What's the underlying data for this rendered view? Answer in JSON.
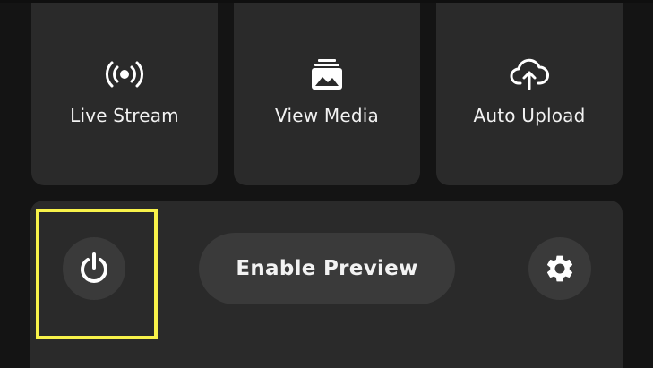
{
  "tiles": [
    {
      "label": "Live Stream",
      "icon": "live-stream-icon"
    },
    {
      "label": "View Media",
      "icon": "media-gallery-icon"
    },
    {
      "label": "Auto Upload",
      "icon": "cloud-upload-icon"
    }
  ],
  "controls": {
    "power_icon": "power-icon",
    "preview_label": "Enable Preview",
    "settings_icon": "gear-icon"
  },
  "colors": {
    "highlight": "#f8f24a",
    "tile_bg": "#2a2a2a",
    "button_bg": "#3a3a3a",
    "background": "#141414",
    "text": "#f2f2f2"
  }
}
